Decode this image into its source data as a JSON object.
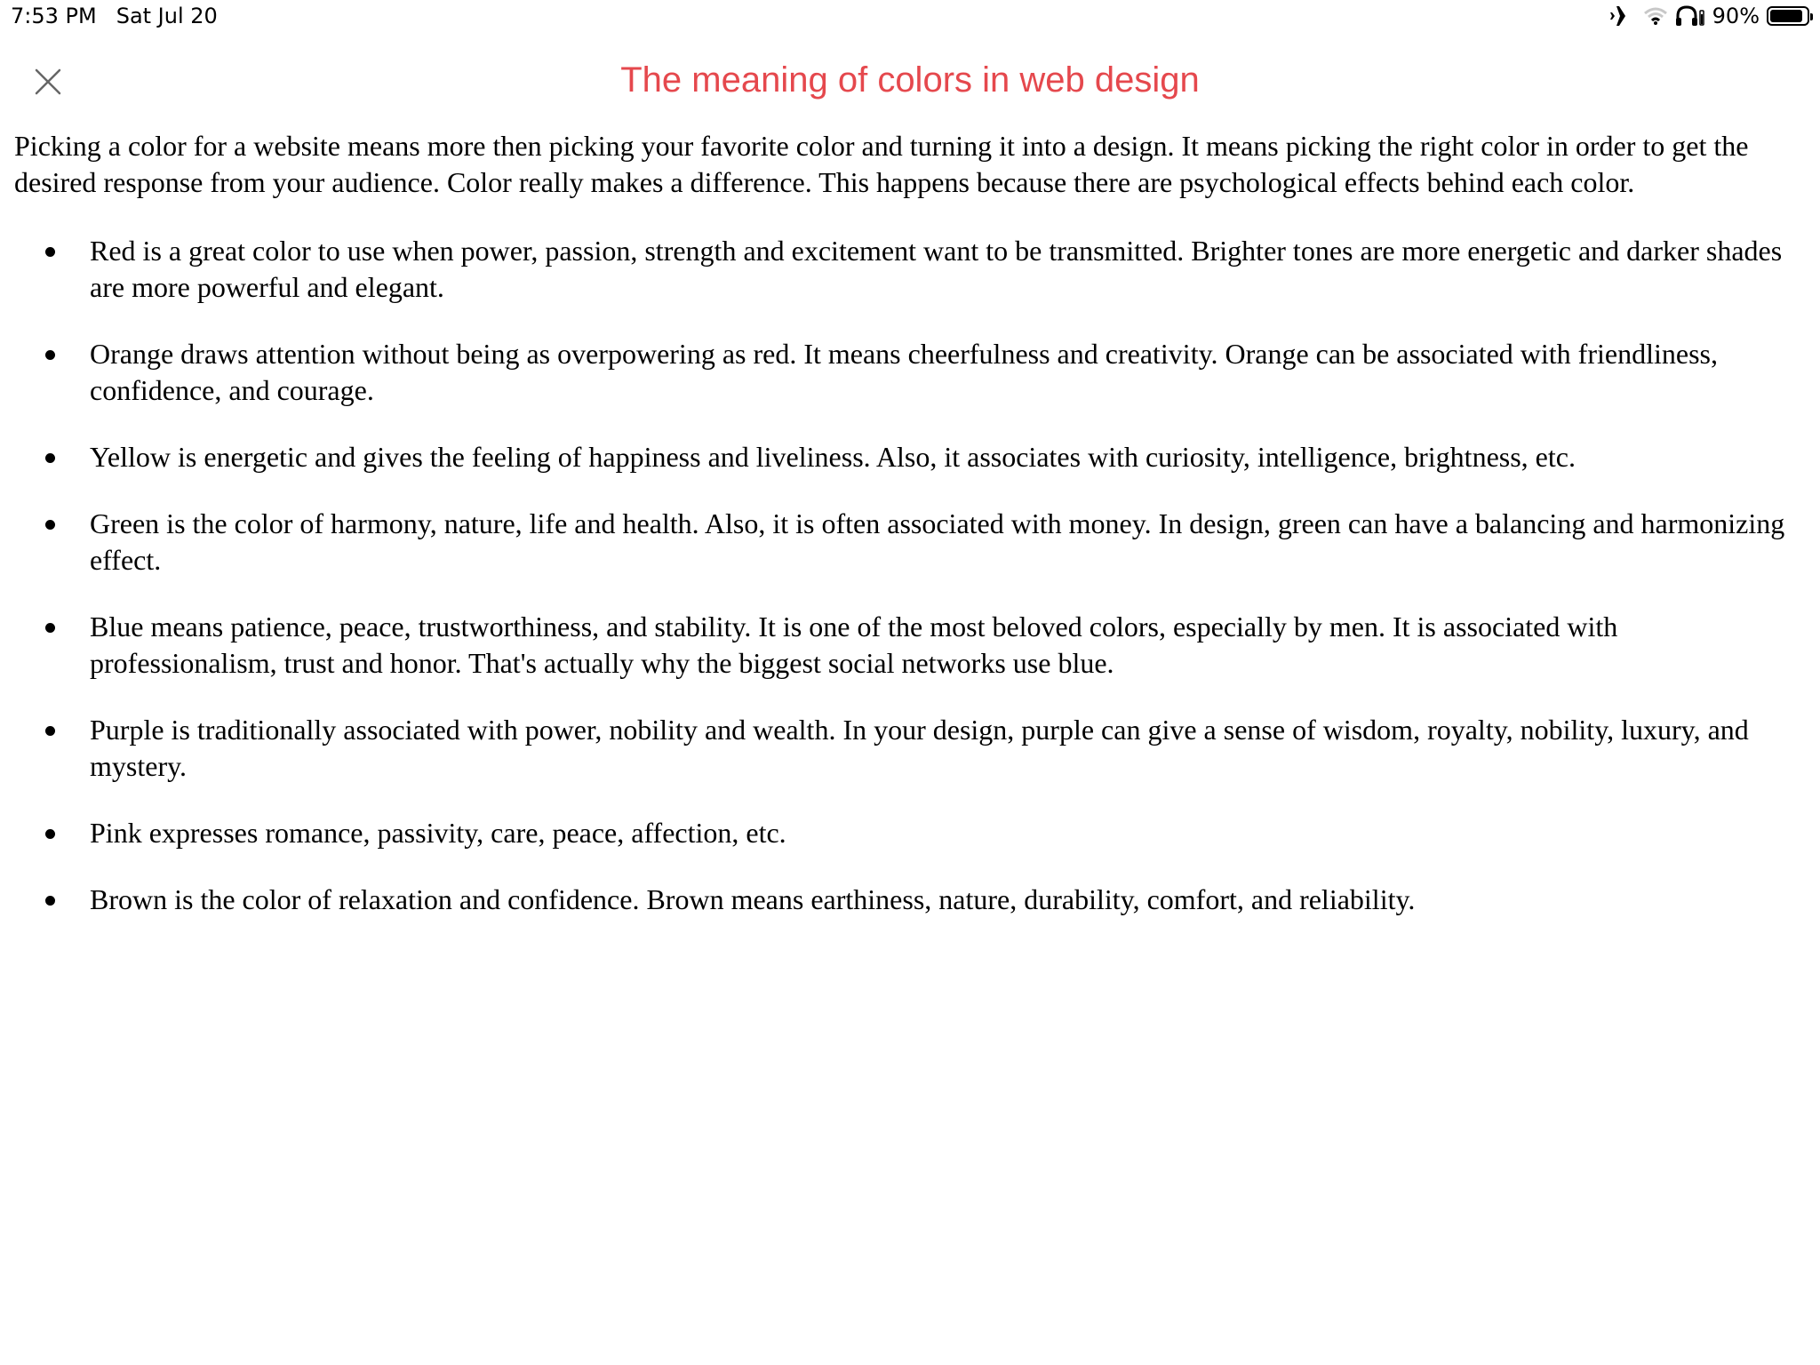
{
  "status_bar": {
    "time": "7:53 PM",
    "date": "Sat Jul 20",
    "battery_label": "90%",
    "battery_level": 0.9,
    "icons": [
      "airplane-icon",
      "wifi-icon",
      "headphones-icon",
      "battery-icon"
    ]
  },
  "header": {
    "title": "The meaning of colors in web design",
    "close_icon": "close-icon"
  },
  "article": {
    "intro": "Picking a color for a website means more then picking your favorite color and turning it into a design. It means picking the right color in order to get the desired response from your audience. Color really makes a difference. This happens because there are psychological effects behind each color.",
    "items": [
      "Red is a great color to use when power, passion, strength and excitement want to be transmitted. Brighter tones are more energetic and darker shades are more powerful and elegant.",
      "Orange draws attention without being as overpowering as red. It means cheerfulness and creativity. Orange can be associated with friendliness, confidence, and courage.",
      "Yellow is energetic and gives the feeling of happiness and liveliness. Also, it associates with curiosity, intelligence, brightness, etc.",
      "Green is the color of harmony, nature, life and health. Also, it is often associated with money. In design, green can have a balancing and harmonizing effect.",
      "Blue means patience, peace, trustworthiness, and stability. It is one of the most beloved colors, especially by men. It is associated with professionalism, trust and honor. That's actually why the biggest social networks use blue.",
      "Purple is traditionally associated with power, nobility and wealth. In your design, purple can give a sense of wisdom, royalty, nobility, luxury, and mystery.",
      "Pink expresses romance, passivity, care, peace, affection, etc.",
      "Brown is the color of relaxation and confidence. Brown means earthiness, nature, durability, comfort, and reliability."
    ]
  },
  "colors": {
    "title": "#e5484d",
    "text": "#000000",
    "background": "#ffffff"
  }
}
